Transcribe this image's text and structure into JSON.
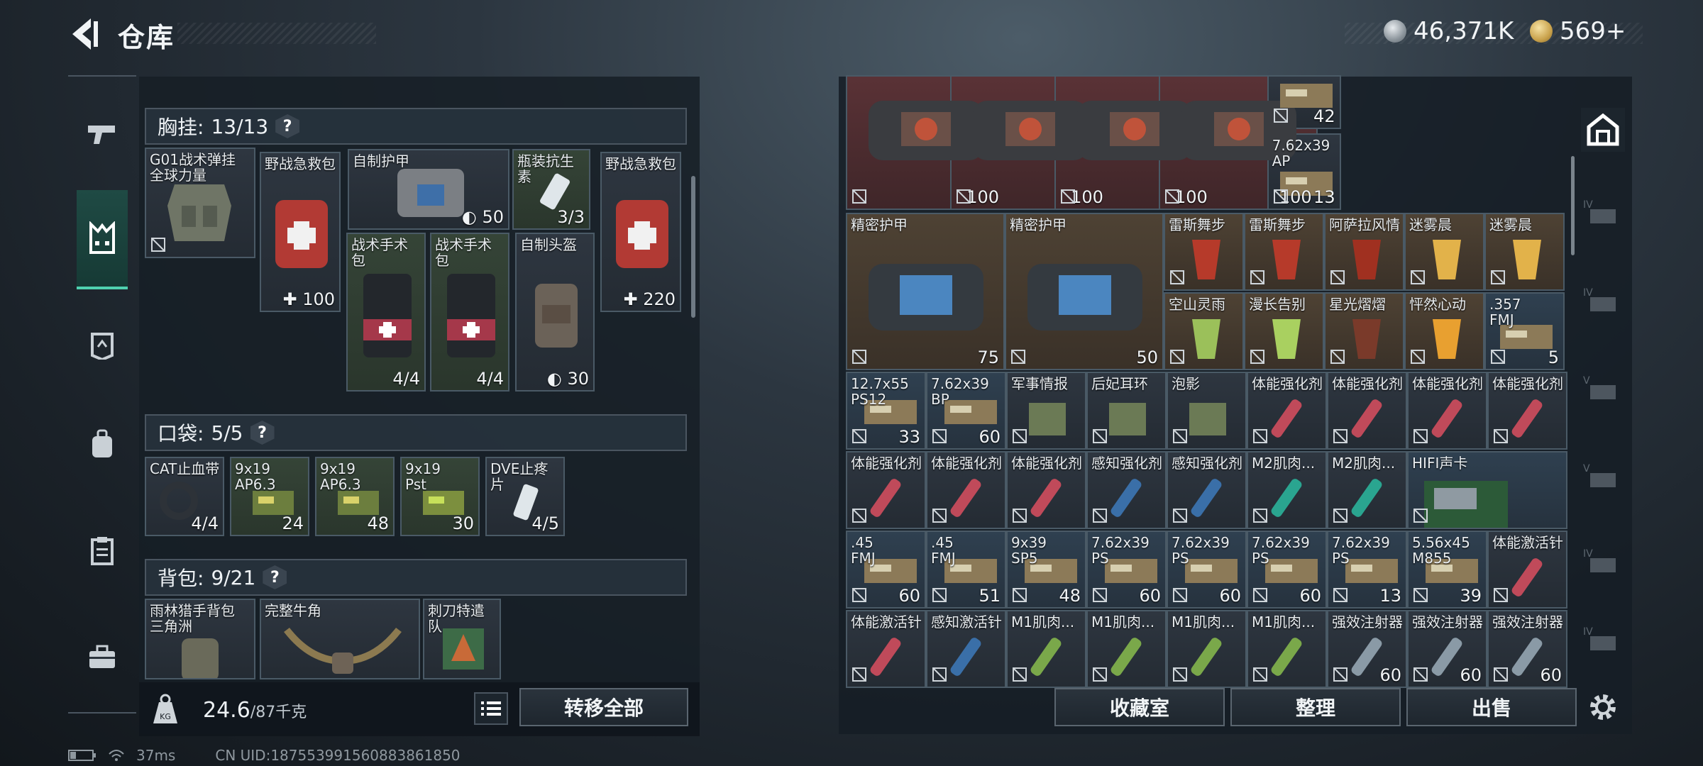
{
  "header": {
    "title": "仓库"
  },
  "currency": {
    "coins": "46,371K",
    "tokens": "569+"
  },
  "status": {
    "ping": "37ms",
    "uid": "CN UID:18755399156088386185​0"
  },
  "sections": {
    "chest": {
      "label": "胸挂:",
      "count": "13/13"
    },
    "pocket": {
      "label": "口袋:",
      "count": "5/5"
    },
    "backpack": {
      "label": "背包:",
      "count": "9/21"
    }
  },
  "chest_items": [
    {
      "name": "G01战术弹挂\n全球力量",
      "count": ""
    },
    {
      "name": "野战急救包",
      "count": "100"
    },
    {
      "name": "自制护甲",
      "count": "50"
    },
    {
      "name": "瓶装抗生素",
      "count": "3/3"
    },
    {
      "name": "野战急救包",
      "count": "220"
    },
    {
      "name": "战术手术包",
      "count": "4/4"
    },
    {
      "name": "战术手术包",
      "count": "4/4"
    },
    {
      "name": "自制头盔",
      "count": "30"
    }
  ],
  "pocket_items": [
    {
      "name": "CAT止血带",
      "count": "4/4"
    },
    {
      "name": "9x19\nAP6.3",
      "count": "24"
    },
    {
      "name": "9x19\nAP6.3",
      "count": "48"
    },
    {
      "name": "9x19\nPst",
      "count": "30"
    },
    {
      "name": "DVE止疼片",
      "count": "4/5"
    }
  ],
  "backpack_items": [
    {
      "name": "雨林猎手背包\n三角洲",
      "count": ""
    },
    {
      "name": "完整牛角",
      "count": ""
    },
    {
      "name": "刺刀特遣队",
      "count": ""
    }
  ],
  "weight": {
    "current": "24.6",
    "max": "/87千克"
  },
  "buttons": {
    "transfer_all": "转移全部",
    "collection": "收藏室",
    "organize": "整理",
    "sell": "出售"
  },
  "stash": {
    "row1": [
      {
        "name": "",
        "count": "100"
      },
      {
        "name": "",
        "count": "100"
      },
      {
        "name": "",
        "count": "100"
      },
      {
        "name": "",
        "count": "100"
      },
      {
        "name": "",
        "count": "42"
      },
      {
        "name": "7.62x39\nAP",
        "count": "13"
      }
    ],
    "armor": [
      {
        "name": "精密护甲",
        "count": "75"
      },
      {
        "name": "精密护甲",
        "count": "50"
      }
    ],
    "row2": [
      "雷斯舞步",
      "雷斯舞步",
      "阿萨拉风情",
      "迷雾晨",
      "迷雾晨"
    ],
    "row3": [
      {
        "name": "空山灵雨",
        "count": ""
      },
      {
        "name": "漫长告别",
        "count": ""
      },
      {
        "name": "星光熠熠",
        "count": ""
      },
      {
        "name": "怦然心动",
        "count": ""
      },
      {
        "name": ".357\nFMJ",
        "count": "5"
      }
    ],
    "row4": [
      {
        "name": "12.7x55\nPS12",
        "count": "33"
      },
      {
        "name": "7.62x39\nBP",
        "count": "60"
      },
      {
        "name": "军事情报",
        "count": ""
      },
      {
        "name": "后妃耳环",
        "count": ""
      },
      {
        "name": "泡影",
        "count": ""
      },
      {
        "name": "体能强化剂",
        "count": ""
      },
      {
        "name": "体能强化剂",
        "count": ""
      },
      {
        "name": "体能强化剂",
        "count": ""
      },
      {
        "name": "体能强化剂",
        "count": ""
      }
    ],
    "row5": [
      {
        "name": "体能强化剂",
        "count": ""
      },
      {
        "name": "体能强化剂",
        "count": ""
      },
      {
        "name": "体能强化剂",
        "count": ""
      },
      {
        "name": "感知强化剂",
        "count": ""
      },
      {
        "name": "感知强化剂",
        "count": ""
      },
      {
        "name": "M2肌肉...",
        "count": ""
      },
      {
        "name": "M2肌肉...",
        "count": ""
      },
      {
        "name": "HIFI声卡",
        "count": ""
      }
    ],
    "row6": [
      {
        "name": ".45\nFMJ",
        "count": "60"
      },
      {
        "name": ".45\nFMJ",
        "count": "51"
      },
      {
        "name": "9x39\nSP5",
        "count": "48"
      },
      {
        "name": "7.62x39\nPS",
        "count": "60"
      },
      {
        "name": "7.62x39\nPS",
        "count": "60"
      },
      {
        "name": "7.62x39\nPS",
        "count": "60"
      },
      {
        "name": "7.62x39\nPS",
        "count": "13"
      },
      {
        "name": "5.56x45\nM855",
        "count": "39"
      },
      {
        "name": "体能激活针",
        "count": ""
      }
    ],
    "row7": [
      {
        "name": "体能激活针",
        "count": ""
      },
      {
        "name": "感知激活针",
        "count": ""
      },
      {
        "name": "M1肌肉...",
        "count": ""
      },
      {
        "name": "M1肌肉...",
        "count": ""
      },
      {
        "name": "M1肌肉...",
        "count": ""
      },
      {
        "name": "M1肌肉...",
        "count": ""
      },
      {
        "name": "强效注射器",
        "count": "60"
      },
      {
        "name": "强效注射器",
        "count": "60"
      },
      {
        "name": "强效注射器",
        "count": "60"
      }
    ]
  }
}
